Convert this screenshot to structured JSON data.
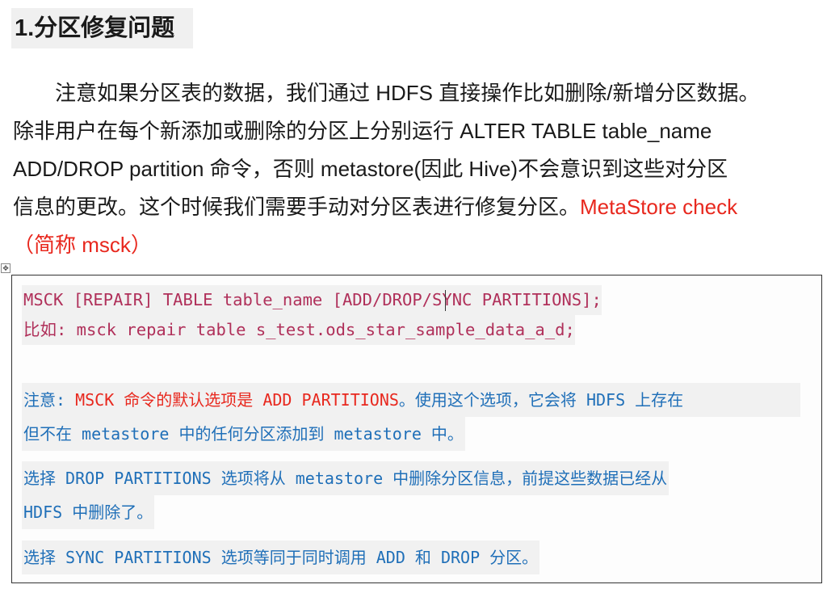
{
  "heading": "1.分区修复问题",
  "paragraph": {
    "lines": [
      "　　注意如果分区表的数据，我们通过 HDFS 直接操作比如删除/新增分区数据。",
      "除非用户在每个新添加或删除的分区上分别运行 ALTER TABLE table_name",
      "ADD/DROP partition 命令，否则 metastore(因此 Hive)不会意识到这些对分区",
      "信息的更改。这个时候我们需要手动对分区表进行修复分区。"
    ],
    "highlight_1": "MetaStore check",
    "highlight_2": "（简称 msck）"
  },
  "table_handle": "✥",
  "code": {
    "syntax": "MSCK [REPAIR] TABLE table_name [ADD/DROP/SYNC PARTITIONS];",
    "example": "比如: msck repair table s_test.ods_star_sample_data_a_d;"
  },
  "notes": {
    "n1_label": "注意:",
    "n1_red": " MSCK 命令的默认选项是 ADD PARTITIONS",
    "n1_rest": "。使用这个选项，它会将 HDFS 上存在",
    "n1_line2": "但不在 metastore 中的任何分区添加到 metastore 中。",
    "n2_line1": "选择 DROP PARTITIONS 选项将从 metastore 中删除分区信息，前提这些数据已经从",
    "n2_line2": "HDFS 中删除了。",
    "n3": "选择 SYNC PARTITIONS 选项等同于同时调用 ADD 和 DROP 分区。"
  },
  "colors": {
    "accent_red": "#e8281e",
    "code": "#b0305a",
    "note_blue": "#1f6fb8"
  }
}
